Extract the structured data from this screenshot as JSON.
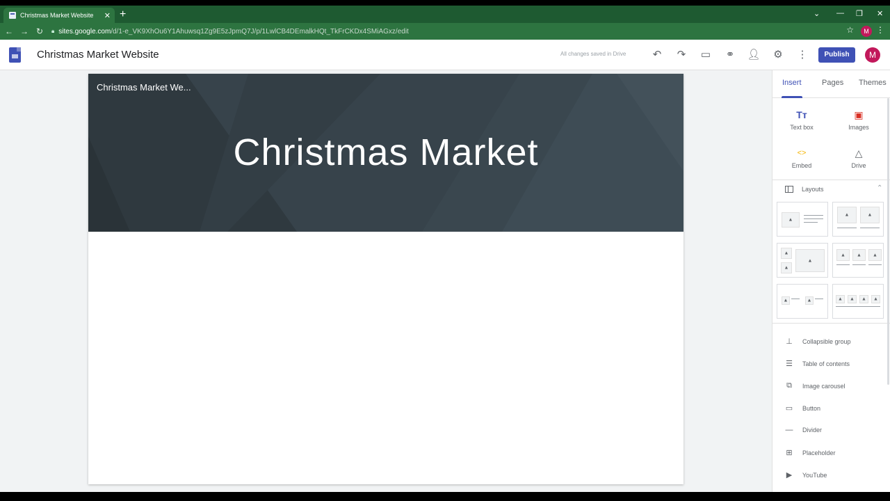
{
  "browser": {
    "tab_title": "Christmas Market Website",
    "tab_close": "✕",
    "new_tab": "+",
    "win_minimize": "—",
    "win_restore": "❐",
    "win_close": "✕",
    "win_dropdown": "⌄",
    "url_host": "sites.google.com",
    "url_path": "/d/1-e_VK9XhOu6Y1Ahuwsq1Zg9E5zJpmQ7J/p/1LwlCB4DEmalkHQt_TkFrCKDx4SMiAGxz/edit",
    "profile_letter": "M"
  },
  "header": {
    "site_title": "Christmas Market Website",
    "saved_status": "All changes saved in Drive",
    "publish_label": "Publish",
    "avatar_letter": "M"
  },
  "page": {
    "site_name": "Christmas Market We...",
    "hero_title": "Christmas Market"
  },
  "panel": {
    "tabs": [
      "Insert",
      "Pages",
      "Themes"
    ],
    "insert_tools": [
      {
        "label": "Text box",
        "icon": "text-box-icon"
      },
      {
        "label": "Images",
        "icon": "image-icon"
      },
      {
        "label": "Embed",
        "icon": "embed-icon"
      },
      {
        "label": "Drive",
        "icon": "drive-icon"
      }
    ],
    "layouts_label": "Layouts",
    "elements": [
      {
        "label": "Collapsible group",
        "icon": "collapsible-group-icon"
      },
      {
        "label": "Table of contents",
        "icon": "table-of-contents-icon"
      },
      {
        "label": "Image carousel",
        "icon": "image-carousel-icon"
      },
      {
        "label": "Button",
        "icon": "button-icon"
      },
      {
        "label": "Divider",
        "icon": "divider-icon"
      },
      {
        "label": "Placeholder",
        "icon": "placeholder-icon"
      },
      {
        "label": "YouTube",
        "icon": "youtube-icon"
      }
    ]
  },
  "colors": {
    "browser_frame": "#1e5a31",
    "accent": "#3f51b5",
    "hero_bg": "#37434b",
    "avatar": "#c2185b"
  }
}
